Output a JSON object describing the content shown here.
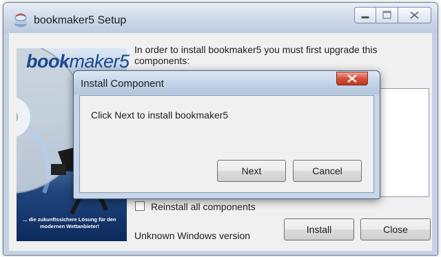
{
  "window": {
    "title": "bookmaker5 Setup"
  },
  "banner": {
    "logo_bold": "book",
    "logo_thin": "maker5",
    "tagline": "... die zukunftssichere Lösung für den modernen Wettanbieter!"
  },
  "main": {
    "intro": "In order to install bookmaker5 you must first upgrade this components:",
    "reinstall_label": "Reinstall all components",
    "reinstall_checked": false,
    "status": "Unknown Windows version",
    "install_label": "Install",
    "close_label": "Close"
  },
  "dialog": {
    "title": "Install Component",
    "message": "Click Next to install bookmaker5",
    "next_label": "Next",
    "cancel_label": "Cancel"
  },
  "icons": {
    "app": "setup-box-icon",
    "minimize": "minimize-icon",
    "maximize": "maximize-icon",
    "close": "close-icon"
  },
  "colors": {
    "titlebar": "#cfdaea",
    "dialog_close": "#c2331c",
    "logo": "#1a4a8f"
  }
}
